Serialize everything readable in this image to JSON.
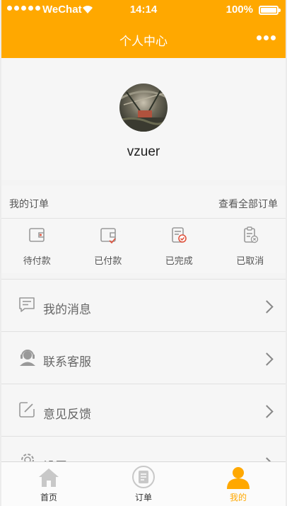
{
  "status_bar": {
    "carrier": "WeChat",
    "time": "14:14",
    "battery": "100%"
  },
  "nav": {
    "title": "个人中心",
    "more_icon": "more-dots-icon"
  },
  "profile": {
    "username": "vzuer"
  },
  "orders": {
    "title": "我的订单",
    "view_all": "查看全部订单",
    "items": [
      {
        "label": "待付款",
        "icon": "wallet-pending-icon"
      },
      {
        "label": "已付款",
        "icon": "wallet-paid-icon"
      },
      {
        "label": "已完成",
        "icon": "order-completed-icon"
      },
      {
        "label": "已取消",
        "icon": "order-cancelled-icon"
      }
    ]
  },
  "menu": [
    {
      "label": "我的消息",
      "icon": "message-icon"
    },
    {
      "label": "联系客服",
      "icon": "customer-service-icon"
    },
    {
      "label": "意见反馈",
      "icon": "feedback-edit-icon"
    },
    {
      "label": "设置",
      "icon": "gear-icon"
    }
  ],
  "tabbar": [
    {
      "label": "首页",
      "icon": "home-icon",
      "active": false
    },
    {
      "label": "订单",
      "icon": "order-list-icon",
      "active": false
    },
    {
      "label": "我的",
      "icon": "user-icon",
      "active": true
    }
  ],
  "colors": {
    "accent": "#ffa800",
    "background": "#f4f4f4",
    "icon_gray": "#999999"
  }
}
